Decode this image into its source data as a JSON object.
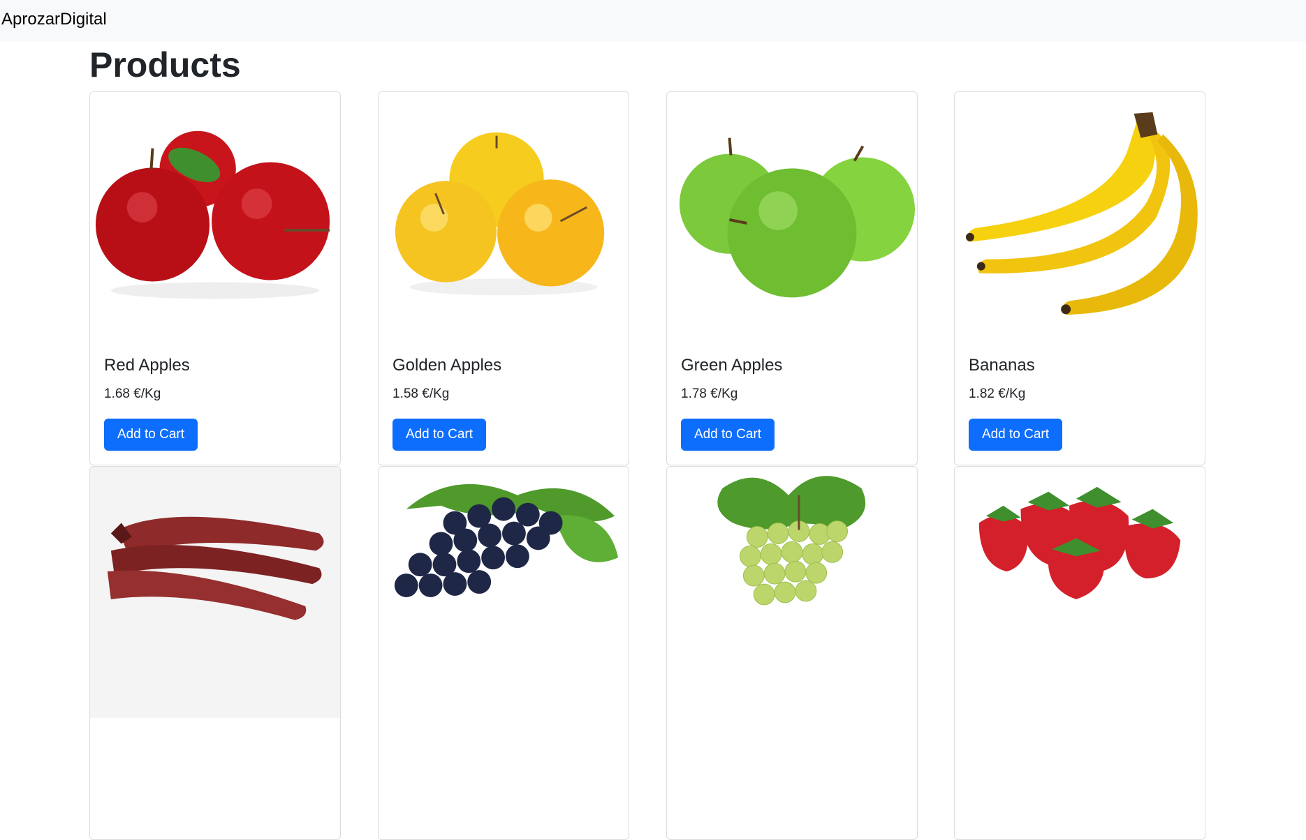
{
  "navbar": {
    "brand": "AprozarDigital"
  },
  "page": {
    "title": "Products"
  },
  "products": [
    {
      "name": "Red Apples",
      "price": "1.68 €/Kg",
      "button": "Add to Cart",
      "image_icon": "red-apples-image"
    },
    {
      "name": "Golden Apples",
      "price": "1.58 €/Kg",
      "button": "Add to Cart",
      "image_icon": "golden-apples-image"
    },
    {
      "name": "Green Apples",
      "price": "1.78 €/Kg",
      "button": "Add to Cart",
      "image_icon": "green-apples-image"
    },
    {
      "name": "Bananas",
      "price": "1.82 €/Kg",
      "button": "Add to Cart",
      "image_icon": "bananas-image"
    }
  ],
  "products_row2": [
    {
      "image_icon": "red-bananas-image"
    },
    {
      "image_icon": "black-grapes-image"
    },
    {
      "image_icon": "green-grapes-image"
    },
    {
      "image_icon": "strawberries-image"
    }
  ],
  "colors": {
    "accent": "#0d6efd",
    "navbar_bg": "#f8f9fa"
  }
}
